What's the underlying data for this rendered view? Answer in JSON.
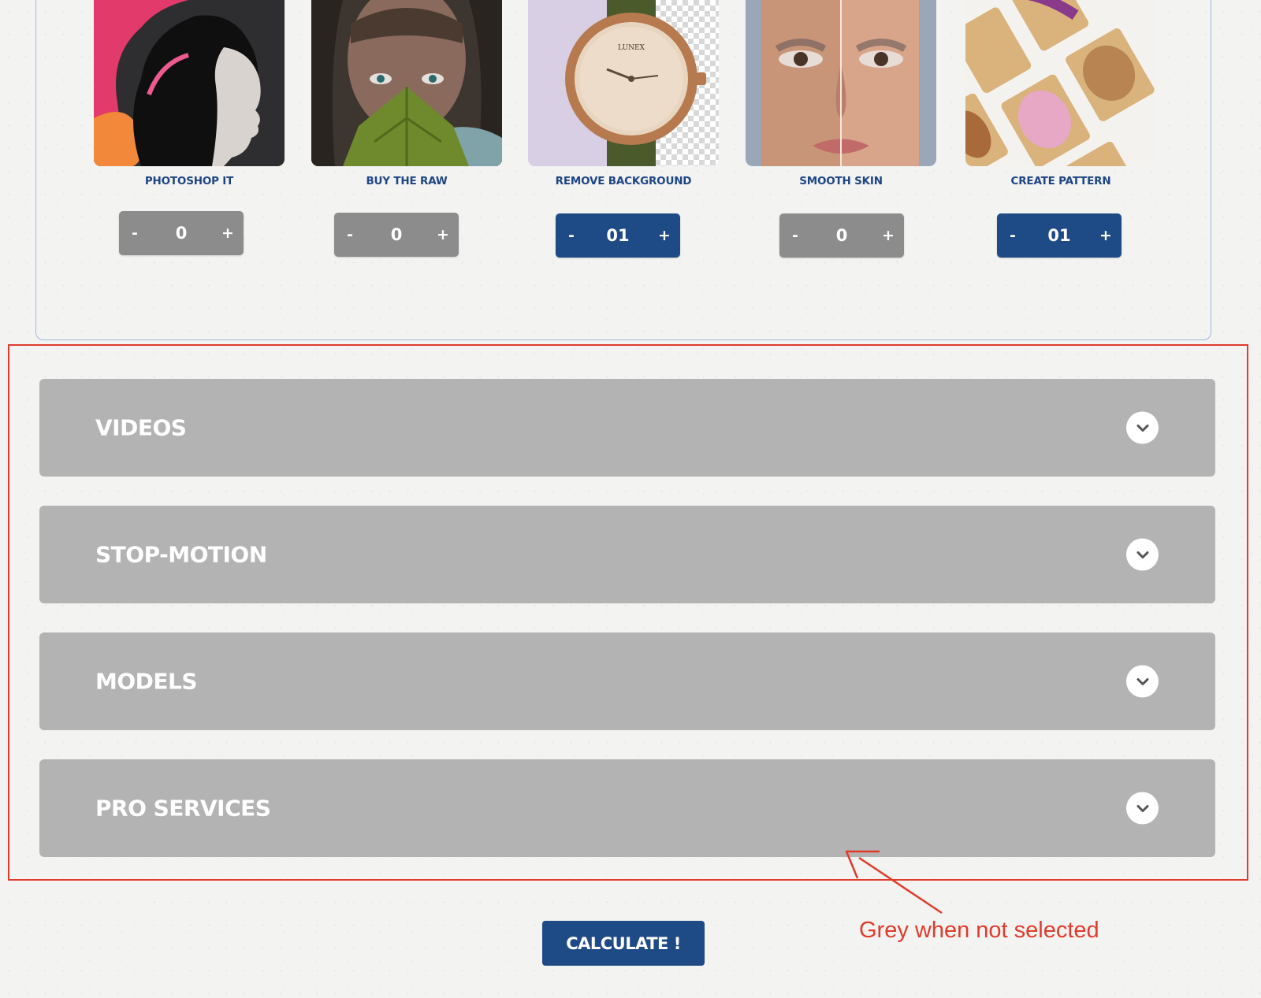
{
  "products": [
    {
      "label": "PHOTOSHOP IT",
      "quantity": "0",
      "selected": false
    },
    {
      "label": "BUY THE RAW",
      "quantity": "0",
      "selected": false
    },
    {
      "label": "REMOVE BACKGROUND",
      "quantity": "01",
      "selected": true
    },
    {
      "label": "SMOOTH SKIN",
      "quantity": "0",
      "selected": false
    },
    {
      "label": "CREATE PATTERN",
      "quantity": "01",
      "selected": true
    }
  ],
  "stepper": {
    "minus": "-",
    "plus": "+"
  },
  "watch_brand": "LUNEX",
  "categories": [
    {
      "title": "VIDEOS"
    },
    {
      "title": "STOP-MOTION"
    },
    {
      "title": "MODELS"
    },
    {
      "title": "PRO SERVICES"
    }
  ],
  "calculate_label": "CALCULATE !",
  "annotation": {
    "text": "Grey when not selected"
  },
  "colors": {
    "brand_blue": "#1e4a86",
    "unselected_grey": "#8c8c8c",
    "category_grey": "#b3b3b3",
    "annotation_red": "#e03b2b"
  }
}
